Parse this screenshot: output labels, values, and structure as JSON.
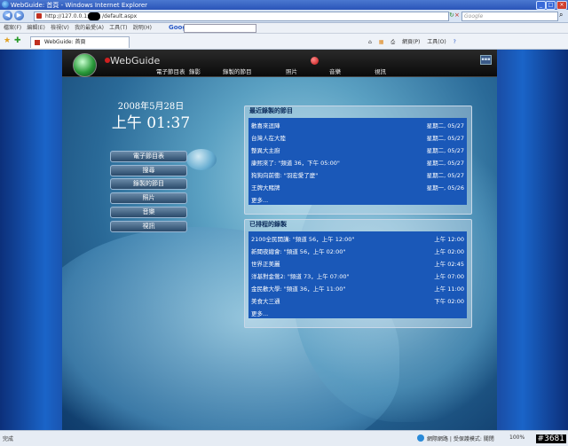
{
  "window": {
    "title": "WebGuide: 首頁 - Windows Internet Explorer",
    "address": "http://127.0.0.1:",
    "address_suffix": "/default.aspx",
    "search_placeholder": "Google"
  },
  "menubar": {
    "items": [
      "檔案(F)",
      "編輯(E)",
      "檢視(V)",
      "我的最愛(A)",
      "工具(T)",
      "說明(H)"
    ],
    "google_label": "Google"
  },
  "tab": {
    "label": "WebGuide: 首頁"
  },
  "commandbar": {
    "page_label": "網頁(P)",
    "tools_label": "工具(O)"
  },
  "app": {
    "logo_text": "WebGuide",
    "nav": [
      "電子節目表",
      "錄影",
      "錄製的節目",
      "照片",
      "音樂",
      "視訊"
    ]
  },
  "clock": {
    "date": "2008年5月28日",
    "time": "上午 01:37"
  },
  "menu_buttons": [
    "電子節目表",
    "搜尋",
    "錄製的節目",
    "照片",
    "音樂",
    "視訊"
  ],
  "recent": {
    "title": "最近錄製的節目",
    "items": [
      {
        "name": "歡喜來逗陣",
        "when": "星期二, 05/27"
      },
      {
        "name": "台灣人在大陸",
        "when": "星期二, 05/27"
      },
      {
        "name": "整異大主廚",
        "when": "星期二, 05/27"
      },
      {
        "name": "康熙來了: \"頻道 36，下午 05:00\"",
        "when": "星期二, 05/27"
      },
      {
        "name": "狗狗向前衝: \"羽宏愛了麼\"",
        "when": "星期二, 05/27"
      },
      {
        "name": "王牌大賭牌",
        "when": "星期一, 05/26"
      }
    ],
    "more": "更多..."
  },
  "scheduled": {
    "title": "已排程的錄製",
    "items": [
      {
        "name": "2100全民開講: \"頻道 56，上午 12:00\"",
        "when": "上午 12:00"
      },
      {
        "name": "新聞夜總會: \"頻道 56，上午 02:00\"",
        "when": "上午 02:00"
      },
      {
        "name": "世界正美麗",
        "when": "上午 02:45"
      },
      {
        "name": "洋基對金鶯2: \"頻道 73，上午 07:00\"",
        "when": "上午 07:00"
      },
      {
        "name": "金民歡大學: \"頻道 36，上午 11:00\"",
        "when": "上午 11:00"
      },
      {
        "name": "美食大三通",
        "when": "下午 02:00"
      }
    ],
    "more": "更多..."
  },
  "status": {
    "left": "完成",
    "zone": "網際網路 | 受保護模式: 關閉",
    "zoom": "100%"
  },
  "watermark": "#3681"
}
